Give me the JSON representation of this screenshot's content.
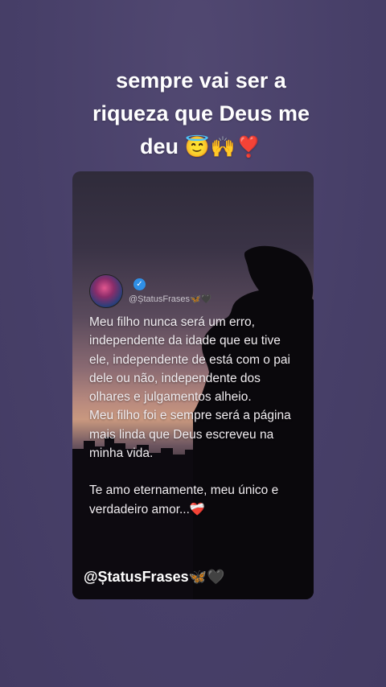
{
  "headline": {
    "line1": "sempre vai ser a",
    "line2": "riqueza que Deus me",
    "line3_text": "deu",
    "line3_emoji": "😇🙌❣️"
  },
  "card": {
    "verified_mark": "✓",
    "handle": "@ȘtatusFrases🦋🖤",
    "quote": {
      "p1": [
        "Meu filho nunca será um erro,",
        "independente da idade que eu tive",
        "ele, independente de está com o pai",
        "dele ou não, independente dos",
        "olhares e julgamentos alheio."
      ],
      "p2": [
        "Meu filho foi e sempre será a página",
        "mais linda que Deus escreveu na",
        "minha vida."
      ],
      "p3": [
        "Te amo eternamente, meu único e",
        "verdadeiro amor...❤️‍🩹"
      ]
    },
    "watermark": "@ȘtatusFrases🦋🖤"
  },
  "colors": {
    "background": "#4a416a",
    "text": "#ffffff",
    "verified": "#2f8fe6"
  },
  "icons": [
    "verified-badge-icon",
    "avatar-image"
  ]
}
